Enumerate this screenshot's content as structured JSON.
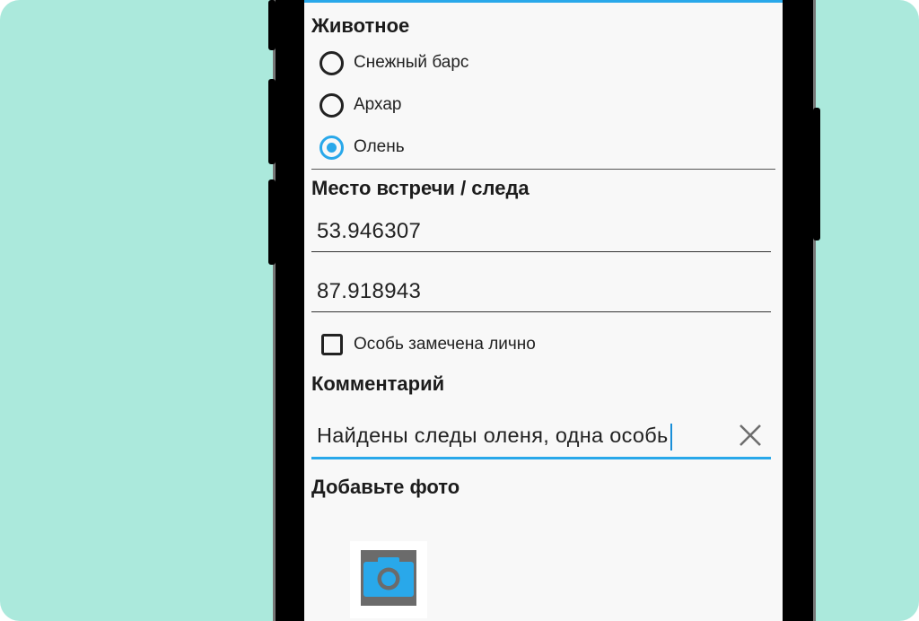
{
  "colors": {
    "background": "#abe9dc",
    "accent": "#29a8ea",
    "screen": "#f8f8f8",
    "text": "#222222"
  },
  "animal_section": {
    "title": "Животное",
    "options": [
      {
        "label": "Снежный барс",
        "checked": false
      },
      {
        "label": "Архар",
        "checked": false
      },
      {
        "label": "Олень",
        "checked": true
      }
    ]
  },
  "location_section": {
    "title": "Место встречи / следа",
    "latitude": "53.946307",
    "longitude": "87.918943",
    "seen_personally": {
      "label": "Особь замечена лично",
      "checked": false
    }
  },
  "comment_section": {
    "title": "Комментарий",
    "value": "Найдены следы оленя, одна особь",
    "clear_icon": "close-icon"
  },
  "photo_section": {
    "title": "Добавьте фото",
    "icon": "camera-icon"
  }
}
